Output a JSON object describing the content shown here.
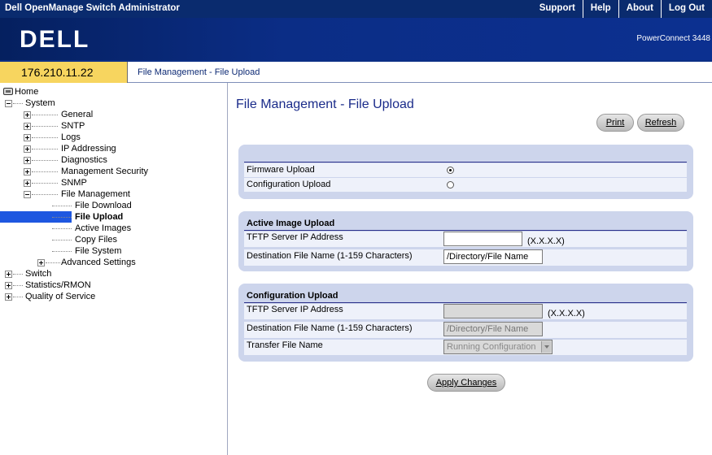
{
  "app": {
    "title": "Dell OpenManage Switch Administrator",
    "nav": [
      "Support",
      "Help",
      "About",
      "Log Out"
    ],
    "logo": "DELL",
    "model": "PowerConnect 3448"
  },
  "address": {
    "ip": "176.210.11.22",
    "breadcrumb": "File Management - File Upload"
  },
  "sidebar": {
    "home": "Home",
    "system": "System",
    "system_items": [
      "General",
      "SNTP",
      "Logs",
      "IP Addressing",
      "Diagnostics",
      "Management Security",
      "SNMP"
    ],
    "file_management": "File Management",
    "file_items": [
      "File Download",
      "File Upload",
      "Active Images",
      "Copy Files",
      "File System"
    ],
    "advanced": "Advanced Settings",
    "top_items": [
      "Switch",
      "Statistics/RMON",
      "Quality of Service"
    ]
  },
  "page": {
    "title": "File Management - File Upload",
    "print": "Print",
    "refresh": "Refresh",
    "upload_type": {
      "firmware": "Firmware Upload",
      "configuration": "Configuration Upload",
      "selected": "firmware"
    },
    "active_image": {
      "title": "Active Image Upload",
      "tftp_label": "TFTP Server IP Address",
      "tftp_value": "",
      "tftp_hint": "(X.X.X.X)",
      "dest_label": "Destination File Name (1-159 Characters)",
      "dest_value": "/Directory/File Name"
    },
    "config_upload": {
      "title": "Configuration Upload",
      "tftp_label": "TFTP Server IP Address",
      "tftp_value": "",
      "tftp_hint": "(X.X.X.X)",
      "dest_label": "Destination File Name (1-159 Characters)",
      "dest_placeholder": "/Directory/File Name",
      "transfer_label": "Transfer File Name",
      "transfer_value": "Running Configuration"
    },
    "apply": "Apply Changes"
  }
}
